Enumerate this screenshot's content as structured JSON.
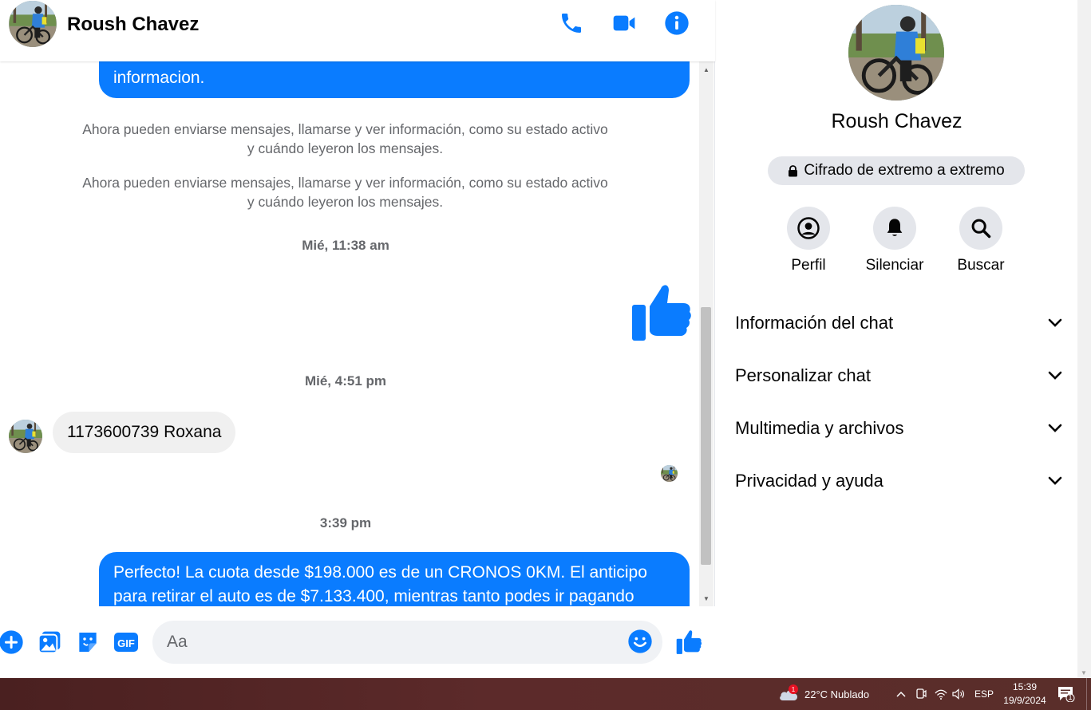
{
  "header": {
    "contact_name": "Roush Chavez"
  },
  "messages": {
    "out_top_text": "informacion.",
    "system_1": "Ahora pueden enviarse mensajes, llamarse y ver información, como su estado activo y cuándo leyeron los mensajes.",
    "system_2": "Ahora pueden enviarse mensajes, llamarse y ver información, como su estado activo y cuándo leyeron los mensajes.",
    "timestamp_1": "Mié, 11:38 am",
    "timestamp_2": "Mié, 4:51 pm",
    "incoming_text": "1173600739 Roxana",
    "timestamp_3": "3:39 pm",
    "out_bottom_text": "Perfecto! La cuota desde $198.000 es de un CRONOS 0KM. El anticipo para retirar el auto es de $7.133.400, mientras tanto podes ir pagando"
  },
  "composer": {
    "placeholder": "Aa",
    "gif_label": "GIF"
  },
  "panel": {
    "name": "Roush Chavez",
    "encryption_label": "Cifrado de extremo a extremo",
    "actions": [
      {
        "label": "Perfil",
        "icon": "profile-icon"
      },
      {
        "label": "Silenciar",
        "icon": "bell-icon"
      },
      {
        "label": "Buscar",
        "icon": "search-icon"
      }
    ],
    "sections": [
      {
        "label": "Información del chat"
      },
      {
        "label": "Personalizar chat"
      },
      {
        "label": "Multimedia y archivos"
      },
      {
        "label": "Privacidad y ayuda"
      }
    ]
  },
  "taskbar": {
    "weather": "22°C  Nublado",
    "notification_count": "1",
    "language": "ESP",
    "time": "15:39",
    "date": "19/9/2024",
    "action_center_count": "1"
  },
  "colors": {
    "accent": "#0a7cff",
    "bubble_in": "#f0f0f0",
    "muted_text": "#65676b"
  }
}
